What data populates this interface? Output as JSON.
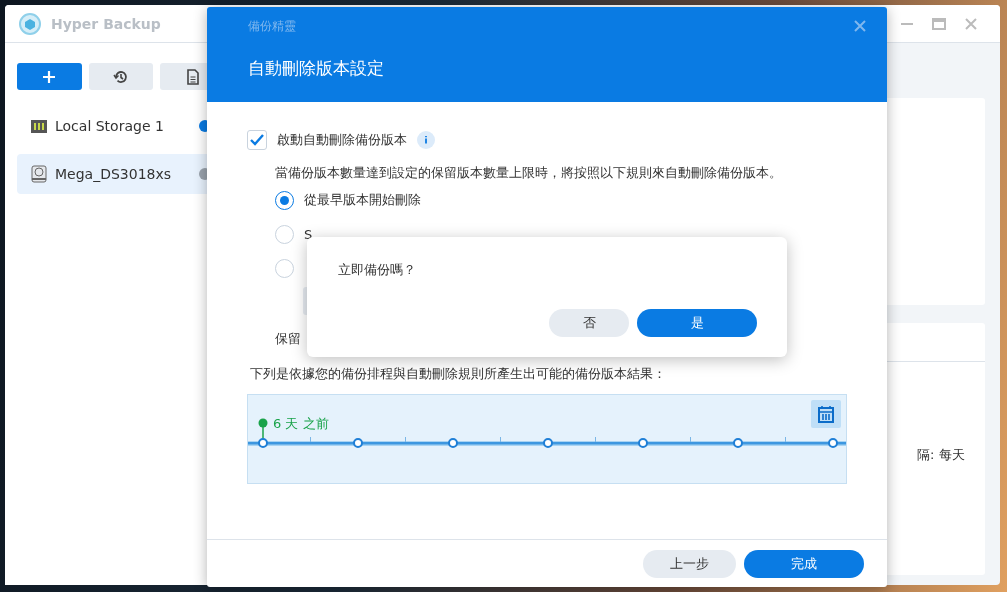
{
  "app": {
    "title": "Hyper Backup",
    "toolbar": [
      {
        "kind": "add"
      },
      {
        "kind": "restore"
      },
      {
        "kind": "log"
      }
    ],
    "sidebar": {
      "items": [
        {
          "label": "Local Storage 1",
          "selected": false,
          "color": "#0a7be3"
        },
        {
          "label": "Mega_DS3018xs",
          "selected": true,
          "color": "#9aa3ad"
        }
      ]
    },
    "detail_text": "隔: 每天"
  },
  "wizard": {
    "caption": "備份精靈",
    "title": "自動刪除版本設定",
    "enable": {
      "label": "啟動自動刪除備份版本",
      "checked": true
    },
    "description": "當備份版本數量達到設定的保留版本數量上限時，將按照以下規則來自動刪除備份版本。",
    "options": [
      {
        "label": "從最早版本開始刪除",
        "selected": true
      },
      {
        "label": "S",
        "selected": false
      },
      {
        "selected": false
      }
    ],
    "retain_label": "保留",
    "result_caption": "下列是依據您的備份排程與自動刪除規則所產生出可能的備份版本結果：",
    "timeline": {
      "marker": "6 天 之前"
    },
    "buttons": [
      {
        "label": "上一步",
        "kind": "secondary"
      },
      {
        "label": "完成",
        "kind": "primary"
      }
    ]
  },
  "confirm": {
    "message": "立即備份嗎？",
    "buttons": [
      {
        "label": "否",
        "kind": "secondary"
      },
      {
        "label": "是",
        "kind": "primary"
      }
    ]
  }
}
